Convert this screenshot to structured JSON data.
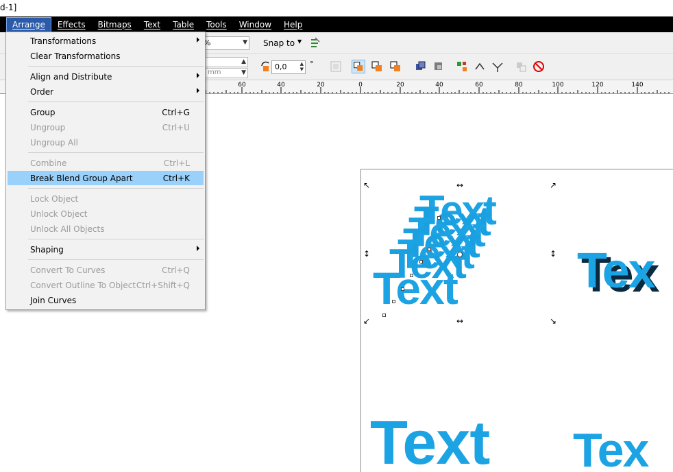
{
  "title_fragment": "d-1]",
  "menubar": [
    {
      "label": "Arrange",
      "active": true
    },
    {
      "label": "Effects"
    },
    {
      "label": "Bitmaps"
    },
    {
      "label": "Text"
    },
    {
      "label": "Table"
    },
    {
      "label": "Tools"
    },
    {
      "label": "Window"
    },
    {
      "label": "Help"
    }
  ],
  "toolbar": {
    "zoom_value": "%",
    "snap_label": "Snap to",
    "rotation_value": "0,0",
    "degree_symbol": "°",
    "unit_text": "mm"
  },
  "ruler": {
    "labels": [
      "60",
      "40",
      "20",
      "0",
      "20",
      "40",
      "60",
      "80",
      "100",
      "120",
      "140"
    ]
  },
  "canvas_text": {
    "blend_word": "Text",
    "extrude_word": "Tex",
    "zigzag_word": "Text",
    "bottom_right_word": "Tex"
  },
  "colors": {
    "accent": "#1ca3e3",
    "menu_highlight": "#99d1fb",
    "menubar_bg": "#000000"
  },
  "arrange_menu": {
    "items": [
      {
        "label": "Transformations",
        "shortcut": "",
        "submenu": true,
        "disabled": false
      },
      {
        "label": "Clear Transformations",
        "shortcut": "",
        "submenu": false,
        "disabled": false
      },
      {
        "label": "Align and Distribute",
        "shortcut": "",
        "submenu": true,
        "disabled": false
      },
      {
        "label": "Order",
        "shortcut": "",
        "submenu": true,
        "disabled": false
      },
      {
        "label": "Group",
        "shortcut": "Ctrl+G",
        "submenu": false,
        "disabled": false
      },
      {
        "label": "Ungroup",
        "shortcut": "Ctrl+U",
        "submenu": false,
        "disabled": true
      },
      {
        "label": "Ungroup All",
        "shortcut": "",
        "submenu": false,
        "disabled": true
      },
      {
        "label": "Combine",
        "shortcut": "Ctrl+L",
        "submenu": false,
        "disabled": true
      },
      {
        "label": "Break Blend Group Apart",
        "shortcut": "Ctrl+K",
        "submenu": false,
        "disabled": false,
        "highlighted": true
      },
      {
        "label": "Lock Object",
        "shortcut": "",
        "submenu": false,
        "disabled": true
      },
      {
        "label": "Unlock Object",
        "shortcut": "",
        "submenu": false,
        "disabled": true
      },
      {
        "label": "Unlock All Objects",
        "shortcut": "",
        "submenu": false,
        "disabled": true
      },
      {
        "label": "Shaping",
        "shortcut": "",
        "submenu": true,
        "disabled": false
      },
      {
        "label": "Convert To Curves",
        "shortcut": "Ctrl+Q",
        "submenu": false,
        "disabled": true
      },
      {
        "label": "Convert Outline To Object",
        "shortcut": "Ctrl+Shift+Q",
        "submenu": false,
        "disabled": true
      },
      {
        "label": "Join Curves",
        "shortcut": "",
        "submenu": false,
        "disabled": false
      }
    ]
  }
}
